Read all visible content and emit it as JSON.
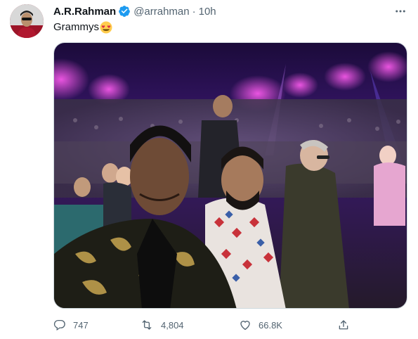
{
  "author": {
    "name": "A.R.Rahman",
    "handle": "@arrahman",
    "time": "10h",
    "separator": "·",
    "verified": true,
    "avatar_icon": "profile-photo"
  },
  "tweet": {
    "text": "Grammys",
    "emoji": "heart-eyes-emoji",
    "media": "photo-selfie-at-grammys-arena"
  },
  "actions": {
    "reply": {
      "icon": "reply-icon",
      "count": "747"
    },
    "retweet": {
      "icon": "retweet-icon",
      "count": "4,804"
    },
    "like": {
      "icon": "heart-icon",
      "count": "66.8K"
    },
    "share": {
      "icon": "share-icon"
    }
  },
  "menu": {
    "icon": "more-options-icon"
  },
  "colors": {
    "text_primary": "#0f1419",
    "text_secondary": "#536471",
    "verified_blue": "#1d9bf0",
    "border": "#cfd9de"
  }
}
